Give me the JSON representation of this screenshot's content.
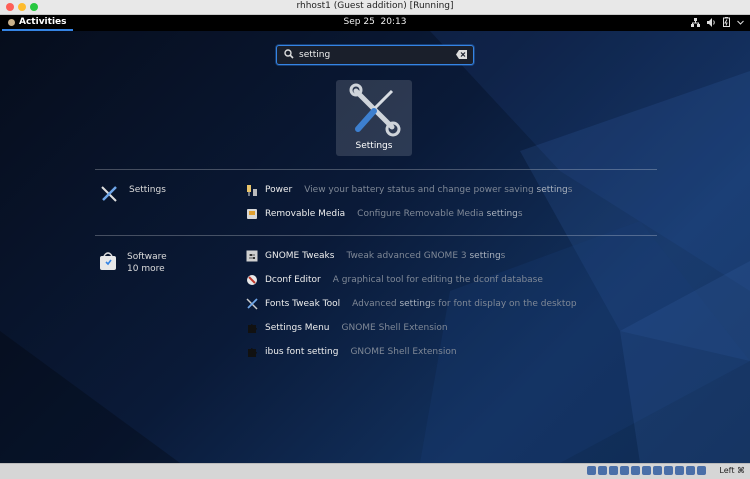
{
  "window": {
    "title": "rhhost1 (Guest addition) [Running]"
  },
  "topbar": {
    "activities": "Activities",
    "date": "Sep 25",
    "time": "20:13"
  },
  "search": {
    "value": "setting"
  },
  "top_app": {
    "label": "Settings"
  },
  "groups": [
    {
      "provider": "Settings",
      "more": "",
      "results": [
        {
          "name": "Power",
          "desc_before": "View your battery status and change power saving ",
          "desc_bold": "setting",
          "desc_after": "s",
          "icon": "power-icon"
        },
        {
          "name": "Removable Media",
          "desc_before": "Configure Removable Media ",
          "desc_bold": "setting",
          "desc_after": "s",
          "icon": "removable-media-icon"
        }
      ]
    },
    {
      "provider": "Software",
      "more": "10 more",
      "results": [
        {
          "name": "GNOME Tweaks",
          "desc_before": "Tweak advanced GNOME 3 ",
          "desc_bold": "setting",
          "desc_after": "s",
          "icon": "gnome-tweaks-icon"
        },
        {
          "name": "Dconf Editor",
          "desc_before": "A graphical tool for editing the dconf database",
          "desc_bold": "",
          "desc_after": "",
          "icon": "dconf-editor-icon"
        },
        {
          "name": "Fonts Tweak Tool",
          "desc_before": "Advanced ",
          "desc_bold": "setting",
          "desc_after": "s for font display on the desktop",
          "icon": "fonts-tweak-tool-icon"
        },
        {
          "name": "Settings Menu",
          "desc_before": "GNOME Shell Extension",
          "desc_bold": "",
          "desc_after": "",
          "icon": "puzzle-icon"
        },
        {
          "name": "ibus font setting",
          "desc_before": "GNOME Shell Extension",
          "desc_bold": "",
          "desc_after": "",
          "icon": "puzzle-icon"
        }
      ]
    }
  ],
  "statusbar": {
    "host_key": "Left ⌘"
  },
  "colors": {
    "accent": "#3584e4",
    "background": "#0b1a33",
    "panel": "#000000"
  }
}
